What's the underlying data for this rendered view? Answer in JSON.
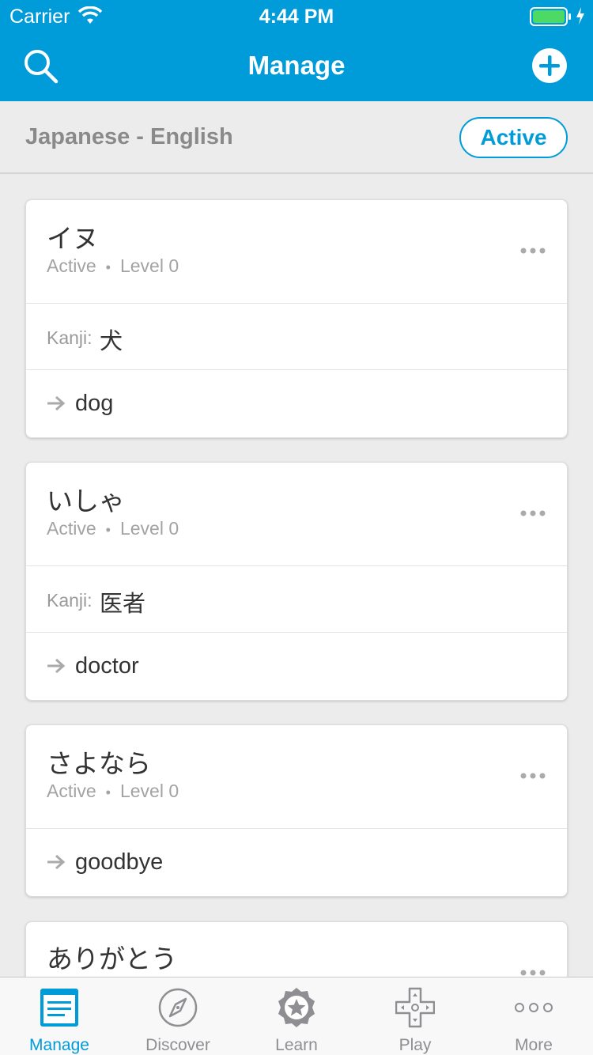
{
  "status": {
    "carrier": "Carrier",
    "time": "4:44 PM"
  },
  "nav": {
    "title": "Manage"
  },
  "deck": {
    "title": "Japanese - English",
    "filter": "Active"
  },
  "cards": [
    {
      "word": "イヌ",
      "status": "Active",
      "level": "Level 0",
      "kanji_label": "Kanji:",
      "kanji": "犬",
      "meaning": "dog"
    },
    {
      "word": "いしゃ",
      "status": "Active",
      "level": "Level 0",
      "kanji_label": "Kanji:",
      "kanji": "医者",
      "meaning": "doctor"
    },
    {
      "word": "さよなら",
      "status": "Active",
      "level": "Level 0",
      "meaning": "goodbye"
    },
    {
      "word": "ありがとう"
    }
  ],
  "tabs": [
    {
      "label": "Manage",
      "icon": "manage-icon",
      "active": true
    },
    {
      "label": "Discover",
      "icon": "compass-icon"
    },
    {
      "label": "Learn",
      "icon": "star-badge-icon"
    },
    {
      "label": "Play",
      "icon": "gamepad-icon"
    },
    {
      "label": "More",
      "icon": "more-dots-icon"
    }
  ],
  "colors": {
    "accent": "#009bd9",
    "background": "#ececec",
    "battery": "#4cd964"
  }
}
